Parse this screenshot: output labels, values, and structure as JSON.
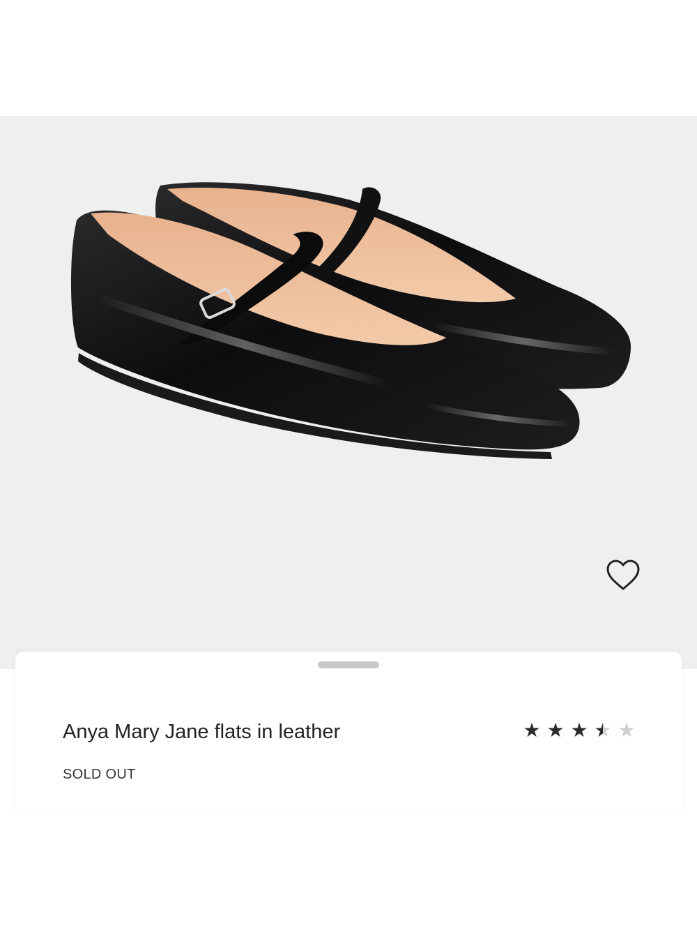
{
  "product": {
    "title": "Anya Mary Jane flats in leather",
    "status": "SOLD OUT",
    "rating": 3.5,
    "rating_max": 5,
    "image": "black patent leather mary jane flats with silver buckle",
    "wishlist_icon": "heart-outline-icon"
  },
  "colors": {
    "image_background": "#efefef",
    "text": "#222222",
    "star_filled": "#2b2b2b",
    "star_empty": "#cfcfcf"
  }
}
